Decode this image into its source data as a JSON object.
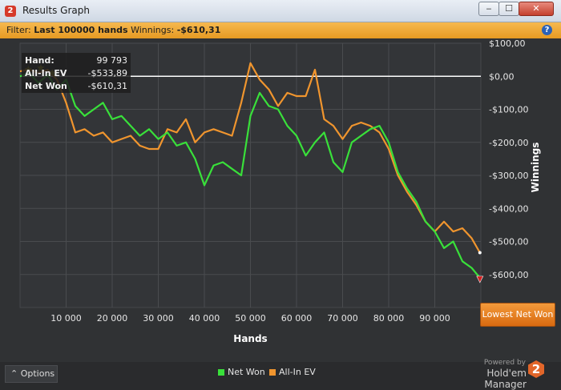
{
  "window": {
    "icon_glyph": "2",
    "title": "Results Graph",
    "minimize_glyph": "‒",
    "maximize_glyph": "☐",
    "close_glyph": "✕"
  },
  "filter": {
    "prefix": "Filter:",
    "value": "Last 100000 hands",
    "winnings_label": "Winnings:",
    "winnings_value": "-$610,31",
    "help_glyph": "?"
  },
  "tooltip": {
    "rows": [
      {
        "label": "Hand:",
        "value": "99 793"
      },
      {
        "label": "All-In EV",
        "value": "-$533,89"
      },
      {
        "label": "Net Won",
        "value": "-$610,31"
      }
    ]
  },
  "buttons": {
    "lowest_net_won": "Lowest Net Won",
    "options": "Options",
    "options_glyph": "⌃"
  },
  "legend": {
    "net_won": "Net Won",
    "all_in_ev": "All-In EV"
  },
  "branding": {
    "powered_by": "Powered by",
    "product": "Hold'em Manager",
    "logo_glyph": "2"
  },
  "colors": {
    "net_won": "#39e03a",
    "all_in_ev": "#f0952e",
    "background": "#303234",
    "grid": "#4a4c4f",
    "zero_line": "#ffffff",
    "accent_orange": "#e69a23"
  },
  "chart_data": {
    "type": "line",
    "xlabel": "Hands",
    "ylabel": "Winnings",
    "xlim": [
      0,
      100000
    ],
    "ylim": [
      -700,
      100
    ],
    "xticks": [
      10000,
      20000,
      30000,
      40000,
      50000,
      60000,
      70000,
      80000,
      90000
    ],
    "xtick_labels": [
      "10 000",
      "20 000",
      "30 000",
      "40 000",
      "50 000",
      "60 000",
      "70 000",
      "80 000",
      "90 000"
    ],
    "yticks": [
      100,
      0,
      -100,
      -200,
      -300,
      -400,
      -500,
      -600
    ],
    "ytick_labels": [
      "$100,00",
      "$0,00",
      "-$100,00",
      "-$200,00",
      "-$300,00",
      "-$400,00",
      "-$500,00",
      "-$600,00"
    ],
    "grid": true,
    "legend_position": "bottom-center",
    "series": [
      {
        "name": "Net Won",
        "x": [
          0,
          2000,
          4000,
          6000,
          8000,
          10000,
          12000,
          14000,
          16000,
          18000,
          20000,
          22000,
          24000,
          26000,
          28000,
          30000,
          32000,
          34000,
          36000,
          38000,
          40000,
          42000,
          44000,
          46000,
          48000,
          50000,
          52000,
          54000,
          56000,
          58000,
          60000,
          62000,
          64000,
          66000,
          68000,
          70000,
          72000,
          74000,
          76000,
          78000,
          80000,
          82000,
          84000,
          86000,
          88000,
          90000,
          92000,
          94000,
          96000,
          98000,
          99793
        ],
        "y": [
          0,
          10,
          -20,
          5,
          -40,
          -10,
          -90,
          -120,
          -100,
          -80,
          -130,
          -120,
          -150,
          -180,
          -160,
          -190,
          -170,
          -210,
          -200,
          -250,
          -330,
          -270,
          -260,
          -280,
          -300,
          -120,
          -50,
          -90,
          -100,
          -150,
          -180,
          -240,
          -200,
          -170,
          -260,
          -290,
          -200,
          -180,
          -160,
          -150,
          -200,
          -290,
          -340,
          -380,
          -440,
          -470,
          -520,
          -500,
          -560,
          -580,
          -610
        ]
      },
      {
        "name": "All-In EV",
        "x": [
          0,
          2000,
          4000,
          6000,
          8000,
          10000,
          12000,
          14000,
          16000,
          18000,
          20000,
          22000,
          24000,
          26000,
          28000,
          30000,
          32000,
          34000,
          36000,
          38000,
          40000,
          42000,
          44000,
          46000,
          48000,
          50000,
          52000,
          54000,
          56000,
          58000,
          60000,
          62000,
          64000,
          66000,
          68000,
          70000,
          72000,
          74000,
          76000,
          78000,
          80000,
          82000,
          84000,
          86000,
          88000,
          90000,
          92000,
          94000,
          96000,
          98000,
          99793
        ],
        "y": [
          15,
          20,
          10,
          20,
          -10,
          -80,
          -170,
          -160,
          -180,
          -170,
          -200,
          -190,
          -180,
          -210,
          -220,
          -220,
          -160,
          -170,
          -130,
          -200,
          -170,
          -160,
          -170,
          -180,
          -80,
          40,
          -10,
          -40,
          -90,
          -50,
          -60,
          -60,
          20,
          -130,
          -150,
          -190,
          -150,
          -140,
          -150,
          -170,
          -220,
          -300,
          -350,
          -390,
          -440,
          -470,
          -440,
          -470,
          -460,
          -490,
          -534
        ]
      }
    ],
    "markers": [
      {
        "series": "Net Won",
        "x": 99793,
        "y": -610
      }
    ]
  }
}
